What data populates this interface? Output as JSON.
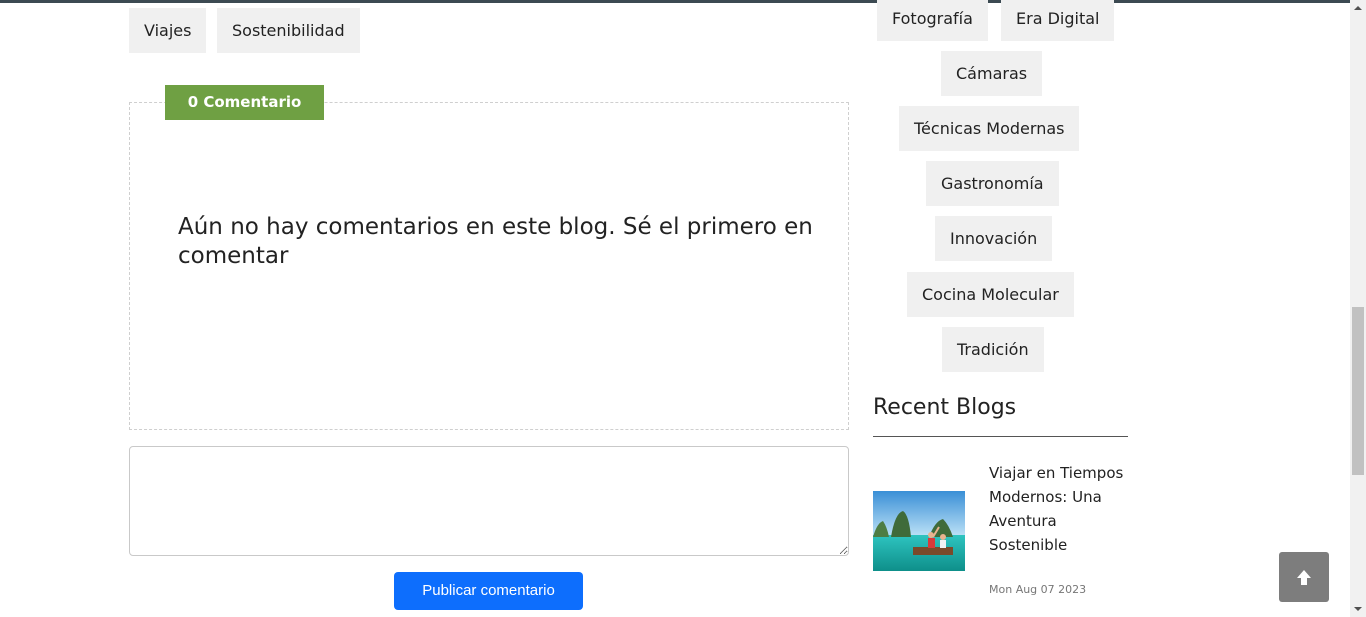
{
  "post_tags": [
    "Viajes",
    "Sostenibilidad"
  ],
  "comments": {
    "badge": "0 Comentario",
    "empty_message": "Aún no hay comentarios en este blog. Sé el primero en comentar",
    "textarea_value": "",
    "publish_label": "Publicar comentario"
  },
  "sidebar": {
    "tags": [
      "Fotografía",
      "Era Digital",
      "Cámaras",
      "Técnicas Modernas",
      "Gastronomía",
      "Innovación",
      "Cocina Molecular",
      "Tradición"
    ],
    "recent_title": "Recent Blogs",
    "recent": [
      {
        "title": "Viajar en Tiempos Modernos: Una Aventura Sostenible",
        "date": "Mon Aug 07 2023"
      }
    ]
  },
  "icons": {
    "back_to_top": "arrow-up-icon"
  },
  "colors": {
    "badge": "#6fa043",
    "publish_button": "#0d6efd",
    "tag_bg": "#f0f0f0",
    "to_top_bg": "#7d7d7d"
  }
}
